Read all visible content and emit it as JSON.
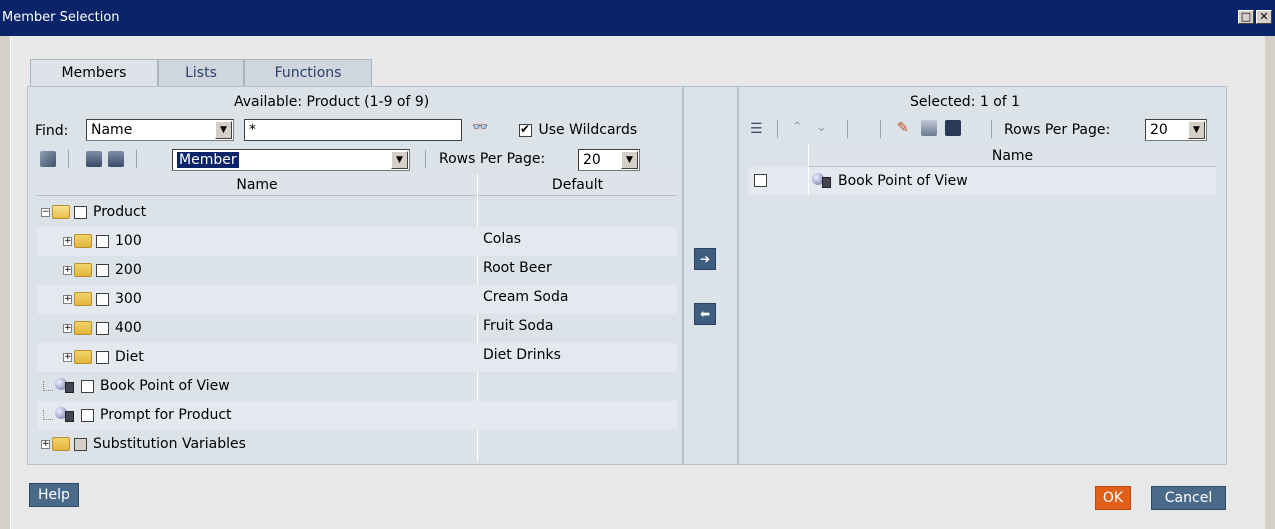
{
  "window": {
    "title": "Member Selection",
    "max_glyph": "□",
    "close_glyph": "✕"
  },
  "tabs": [
    {
      "label": "Members"
    },
    {
      "label": "Lists"
    },
    {
      "label": "Functions"
    }
  ],
  "available": {
    "heading": "Available:  Product (1-9 of 9)",
    "find_label": "Find:",
    "find_field": "Name",
    "find_value": "*",
    "use_wildcards_label": "Use Wildcards",
    "use_wildcards_checked": true,
    "view_select": "Member",
    "rows_per_page_label": "Rows Per Page:",
    "rows_per_page": "20",
    "columns": [
      "Name",
      "Default"
    ],
    "rows": [
      {
        "name": "Product",
        "default": "",
        "icon": "open-folder-icon"
      },
      {
        "name": "100",
        "default": "Colas",
        "icon": "folder-icon"
      },
      {
        "name": "200",
        "default": "Root Beer",
        "icon": "folder-icon"
      },
      {
        "name": "300",
        "default": "Cream Soda",
        "icon": "folder-icon"
      },
      {
        "name": "400",
        "default": "Fruit Soda",
        "icon": "folder-icon"
      },
      {
        "name": "Diet",
        "default": "Diet Drinks",
        "icon": "folder-icon"
      },
      {
        "name": "Book Point of View",
        "default": "",
        "icon": "point-of-view-icon"
      },
      {
        "name": "Prompt for Product",
        "default": "",
        "icon": "point-of-view-icon"
      },
      {
        "name": "Substitution Variables",
        "default": "",
        "icon": "folder-icon"
      }
    ]
  },
  "selected": {
    "heading": "Selected:  1 of 1",
    "rows_per_page_label": "Rows Per Page:",
    "rows_per_page": "20",
    "column": "Name",
    "rows": [
      {
        "name": "Book Point of View",
        "icon": "point-of-view-icon"
      }
    ]
  },
  "move": {
    "add_glyph": "➔",
    "remove_glyph": "⬅"
  },
  "buttons": {
    "help": "Help",
    "ok": "OK",
    "cancel": "Cancel"
  }
}
